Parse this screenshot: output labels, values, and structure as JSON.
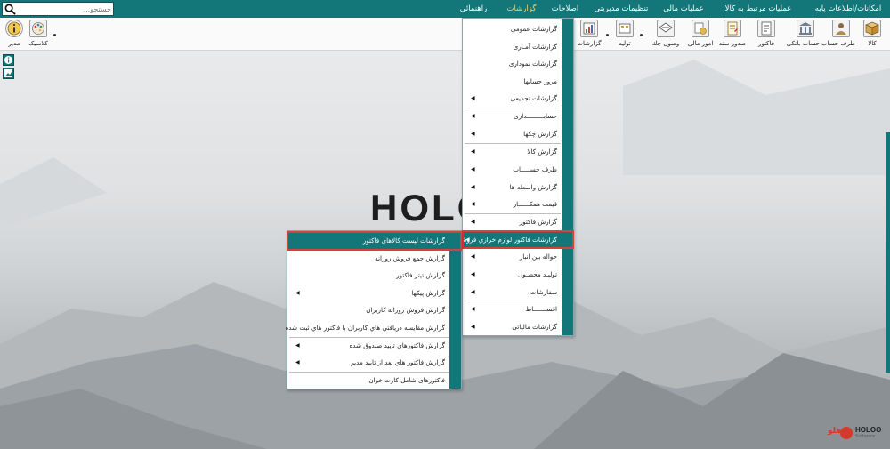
{
  "menubar": {
    "items": [
      {
        "label": "امکانات/اطلاعات پایه",
        "active": false
      },
      {
        "label": "عملیات مرتبط به کالا",
        "active": false
      },
      {
        "label": "عملیات مالی",
        "active": false
      },
      {
        "label": "تنظیمات مدیریتی",
        "active": false
      },
      {
        "label": "اصلاحات",
        "active": false
      },
      {
        "label": "گزارشات",
        "active": true
      },
      {
        "label": "راهنمائی",
        "active": false
      }
    ],
    "search_placeholder": "جستجو..."
  },
  "toolbar": {
    "items": [
      {
        "label": "کالا",
        "icon": "box-icon"
      },
      {
        "label": "طرف حساب",
        "icon": "person-icon"
      },
      {
        "label": "حساب بانکی",
        "icon": "bank-icon"
      },
      {
        "label": "فاکتور",
        "icon": "invoice-icon"
      },
      {
        "label": "صدور سند",
        "icon": "document-icon"
      },
      {
        "label": "امور مالی",
        "icon": "finance-icon"
      },
      {
        "label": "وصول چك",
        "icon": "check-icon"
      },
      {
        "label": "توليد",
        "icon": "production-icon"
      },
      {
        "label": "گزارشات",
        "icon": "report-icon"
      },
      {
        "label": "کلاسیک",
        "icon": "palette-icon"
      },
      {
        "label": "مدیر",
        "icon": "info-icon"
      }
    ]
  },
  "brand": {
    "logo_text": "HOLO",
    "corner_fa": "هلو",
    "corner_en": "HOLOO",
    "corner_sub": "Software",
    "accent": "#13777a",
    "highlight_border": "#d4423a"
  },
  "reports_menu": {
    "items": [
      {
        "label": "گزارشات عمومی",
        "submenu": false
      },
      {
        "label": "گزارشات آمـاری",
        "submenu": false
      },
      {
        "label": "گزارشات نموداری",
        "submenu": false
      },
      {
        "label": "مرور حسابها",
        "submenu": false
      },
      {
        "label": "گزارشات تجمیعی",
        "submenu": true
      },
      {
        "label": "حسابـــــــــداری",
        "submenu": true
      },
      {
        "label": "گزارش چکها",
        "submenu": true
      },
      {
        "label": "گزارش کالا",
        "submenu": true
      },
      {
        "label": "طرف حســـــاب",
        "submenu": true
      },
      {
        "label": "گزارش واسطه ها",
        "submenu": true
      },
      {
        "label": "قیمت همکــــــار",
        "submenu": true
      },
      {
        "label": "گزارش فاکتور",
        "submenu": true
      },
      {
        "label": "گزارشات فاکتور لوازم خرازي فروشي",
        "submenu": true,
        "highlighted": true
      },
      {
        "label": "حواله بین انبار",
        "submenu": true
      },
      {
        "label": "تولیـد محصـول",
        "submenu": true
      },
      {
        "label": "سفارشات",
        "submenu": true
      },
      {
        "label": "اقســـــــاط",
        "submenu": true
      },
      {
        "label": "گزارشات مالیاتی",
        "submenu": true
      }
    ]
  },
  "sub_menu": {
    "items": [
      {
        "label": "گزارشات لیست کالاهای فاکتور",
        "submenu": false,
        "highlighted": true
      },
      {
        "label": "گزارش جمع فروش روزانه",
        "submenu": false
      },
      {
        "label": "گزارش تیتر فاکتور",
        "submenu": false
      },
      {
        "label": "گزارش پیکها",
        "submenu": true
      },
      {
        "label": "گزارش فروش روزانه کاربران",
        "submenu": false
      },
      {
        "label": "گزارش مقايسه دريافتي هاي  كاربران با فاكتور هاي ثبت شده",
        "submenu": false
      },
      {
        "label": "گزارش فاکتورهاي تاييد صندوق شده",
        "submenu": true
      },
      {
        "label": "گزارش فاکتور هاي بعد از تاييد مدير",
        "submenu": true
      },
      {
        "label": "فاکتورهای شامل کارت خوان",
        "submenu": false
      }
    ]
  }
}
